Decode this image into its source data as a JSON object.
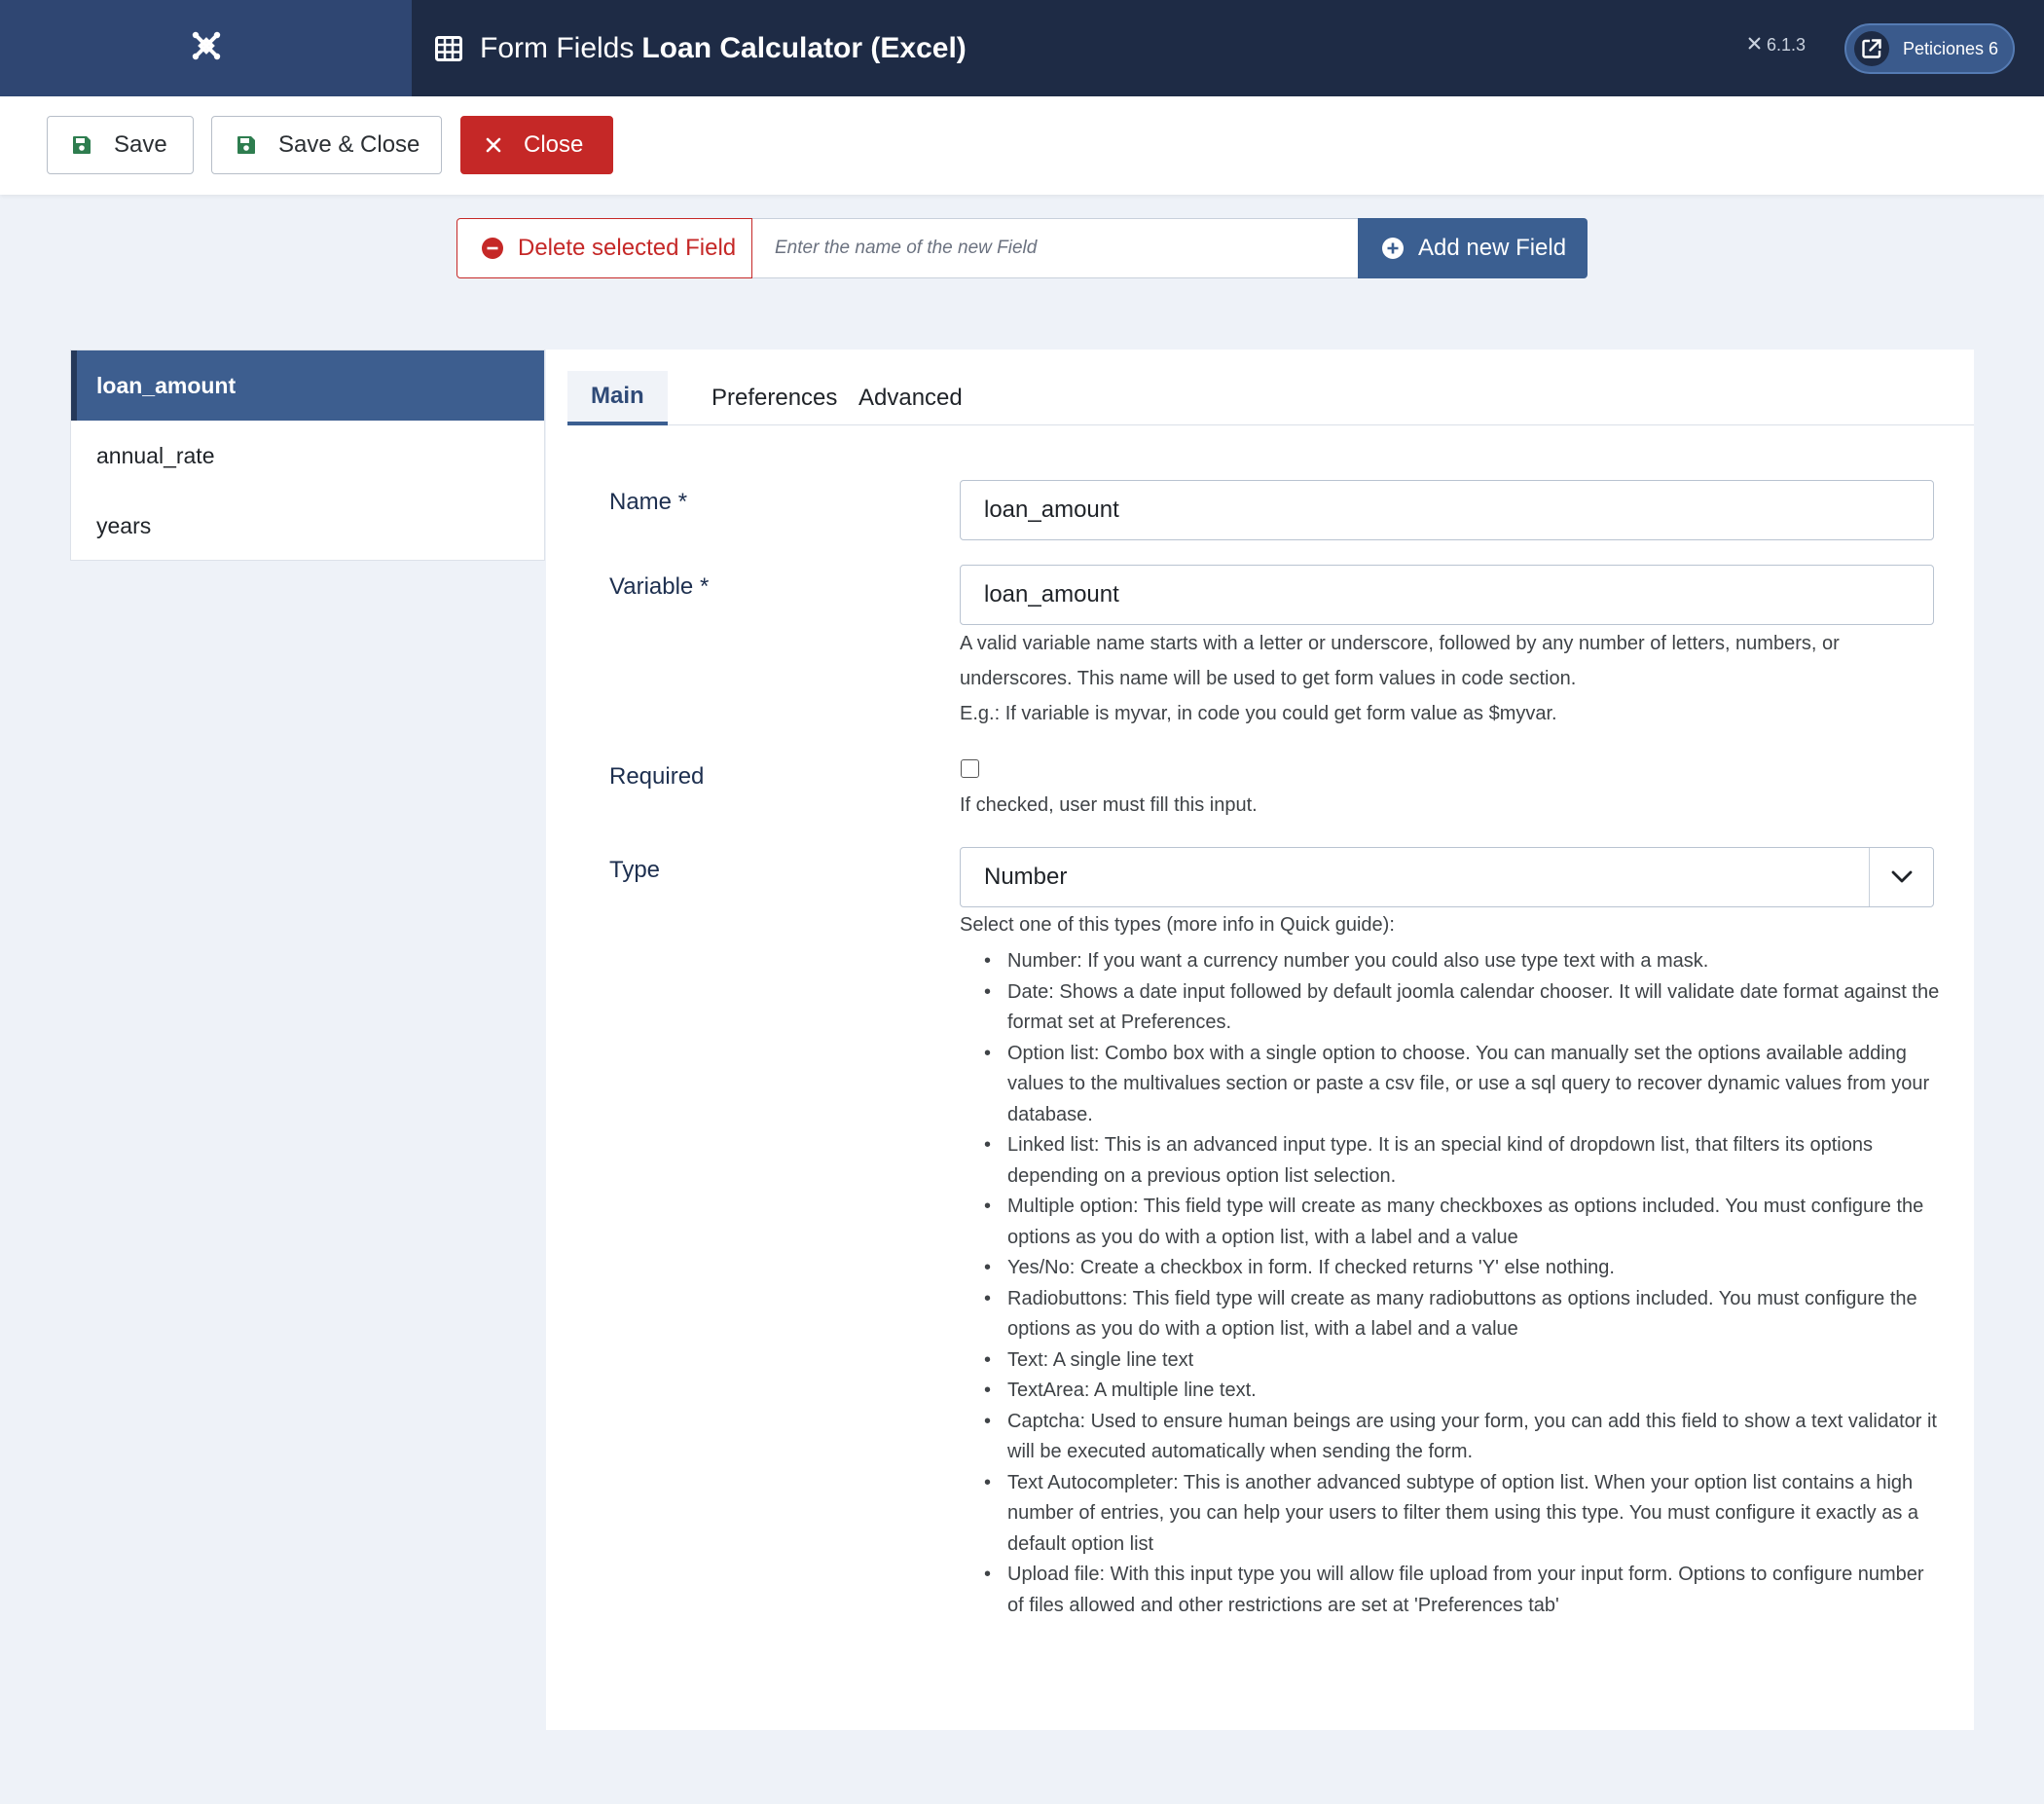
{
  "header": {
    "title_prefix": "Form Fields",
    "title_name": "Loan Calculator (Excel)",
    "version": "6.1.3",
    "requests_label": "Peticiones 6"
  },
  "toolbar": {
    "save_label": "Save",
    "save_close_label": "Save & Close",
    "close_label": "Close"
  },
  "field_actions": {
    "delete_label": "Delete selected Field",
    "new_field_placeholder": "Enter the name of the new Field",
    "add_label": "Add new Field"
  },
  "fields": [
    {
      "label": "loan_amount",
      "active": true
    },
    {
      "label": "annual_rate",
      "active": false
    },
    {
      "label": "years",
      "active": false
    }
  ],
  "tabs": [
    {
      "label": "Main",
      "active": true
    },
    {
      "label": "Preferences",
      "active": false
    },
    {
      "label": "Advanced",
      "active": false
    }
  ],
  "form": {
    "name_label": "Name *",
    "name_value": "loan_amount",
    "variable_label": "Variable *",
    "variable_value": "loan_amount",
    "variable_help_1": "A valid variable name starts with a letter or underscore, followed by any number of letters, numbers, or underscores. This name will be used to get form values in code section.",
    "variable_help_2": "E.g.: If variable is myvar, in code you could get form value as $myvar.",
    "required_label": "Required",
    "required_checked": false,
    "required_help": "If checked, user must fill this input.",
    "type_label": "Type",
    "type_value": "Number",
    "type_intro": "Select one of this types (more info in Quick guide):",
    "type_descriptions": [
      "Number: If you want a currency number you could also use type text with a mask.",
      "Date: Shows a date input followed by default joomla calendar chooser. It will validate date format against the format set at Preferences.",
      "Option list: Combo box with a single option to choose. You can manually set the options available adding values to the multivalues section or paste a csv file, or use a sql query to recover dynamic values from your database.",
      "Linked list: This is an advanced input type. It is an special kind of dropdown list, that filters its options depending on a previous option list selection.",
      "Multiple option: This field type will create as many checkboxes as options included. You must configure the options as you do with a option list, with a label and a value",
      "Yes/No: Create a checkbox in form. If checked returns 'Y' else nothing.",
      "Radiobuttons: This field type will create as many radiobuttons as options included. You must configure the options as you do with a option list, with a label and a value",
      "Text: A single line text",
      "TextArea: A multiple line text.",
      "Captcha: Used to ensure human beings are using your form, you can add this field to show a text validator it will be executed automatically when sending the form.",
      "Text Autocompleter: This is another advanced subtype of option list. When your option list contains a high number of entries, you can help your users to filter them using this type. You must configure it exactly as a default option list",
      "Upload file: With this input type you will allow file upload from your input form. Options to configure number of files allowed and other restrictions are set at 'Preferences tab'"
    ]
  },
  "colors": {
    "header_bg": "#1e2b45",
    "logo_bg": "#2f4672",
    "primary": "#3b5f91",
    "danger": "#c52827",
    "save_icon": "#2e7d4f"
  },
  "icons": {
    "logo": "joomla-logo-icon",
    "title": "table-icon",
    "requests": "external-link-icon",
    "save": "floppy-disk-icon",
    "close": "x-icon",
    "delete": "minus-circle-icon",
    "add": "plus-circle-icon",
    "select": "chevron-down-icon"
  }
}
